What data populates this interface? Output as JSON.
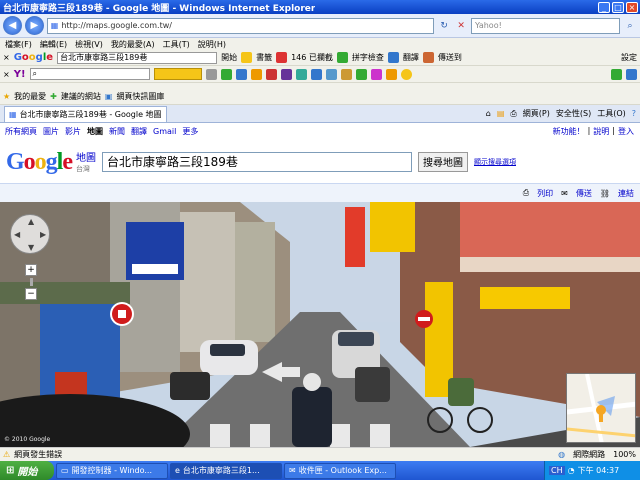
{
  "window": {
    "title": "台北市康寧路三段189巷 - Google 地圖 - Windows Internet Explorer"
  },
  "address": {
    "url": "http://maps.google.com.tw/",
    "search_placeholder": "Yahoo!"
  },
  "menu": [
    "檔案(F)",
    "編輯(E)",
    "檢視(V)",
    "我的最愛(A)",
    "工具(T)",
    "說明(H)"
  ],
  "google_toolbar": {
    "brand": "Google",
    "query": "台北市康寧路三段189巷",
    "go": "開始",
    "bookmarks": "書籤",
    "blocked": "146 已攔截",
    "spell": "拼字檢查",
    "translate": "翻譯",
    "sendto": "傳送到",
    "settings": "設定"
  },
  "yahoo_toolbar": {
    "brand": "Y!"
  },
  "favorites_bar": {
    "favorites": "我的最愛",
    "suggested": "建議的網站",
    "webslices": "網頁快訊圖庫"
  },
  "tab": {
    "label": "台北市康寧路三段189巷 - Google 地圖"
  },
  "tab_tools": {
    "page": "網頁(P)",
    "safety": "安全性(S)",
    "tools": "工具(O)"
  },
  "google_nav": {
    "items": [
      "所有網頁",
      "圖片",
      "影片",
      "地圖",
      "新聞",
      "翻譯",
      "Gmail",
      "更多"
    ],
    "new": "新功能！",
    "help": "說明",
    "login": "登入"
  },
  "header": {
    "logo_sub": "地圖",
    "logo_region": "台灣",
    "search_value": "台北市康寧路三段189巷",
    "search_button": "搜尋地圖",
    "options": "顯示搜尋選項"
  },
  "actions": {
    "print": "列印",
    "send": "傳送",
    "link": "連結"
  },
  "map": {
    "copyright": "© 2010 Google"
  },
  "status": {
    "text": "網頁發生錯誤",
    "zone": "網際網路",
    "zoom": "100%"
  },
  "taskbar": {
    "start": "開始",
    "tasks": [
      "開發控制器 - Windo...",
      "台北市康寧路三段1...",
      "收件匣 - Outlook Exp..."
    ],
    "clock": "下午 04:37",
    "lang": "CH"
  }
}
